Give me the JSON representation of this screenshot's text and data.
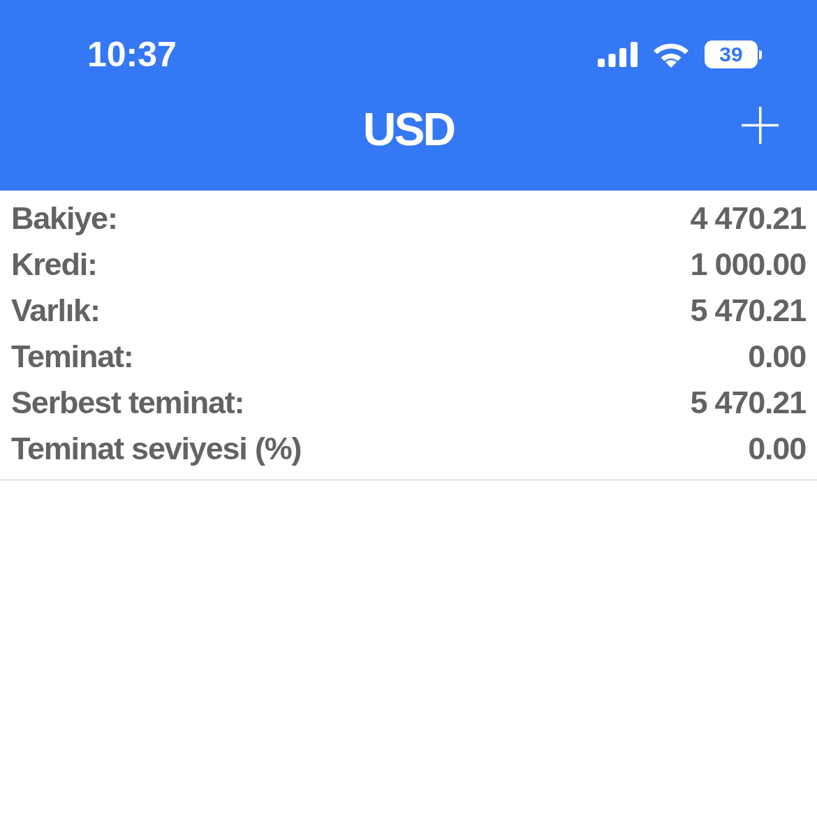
{
  "status_bar": {
    "time": "10:37",
    "battery": "39"
  },
  "header": {
    "title": "USD"
  },
  "rows": [
    {
      "label": "Bakiye:",
      "value": "4 470.21"
    },
    {
      "label": "Kredi:",
      "value": "1 000.00"
    },
    {
      "label": "Varlık:",
      "value": "5 470.21"
    },
    {
      "label": "Teminat:",
      "value": "0.00"
    },
    {
      "label": "Serbest teminat:",
      "value": "5 470.21"
    },
    {
      "label": "Teminat seviyesi (%)",
      "value": "0.00"
    }
  ]
}
